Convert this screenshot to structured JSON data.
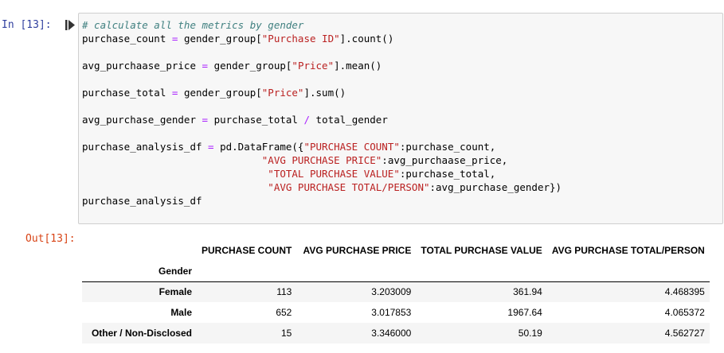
{
  "prompts": {
    "input": "In [13]:",
    "output": "Out[13]:"
  },
  "code": {
    "comment": "# calculate all the metrics by gender",
    "l1": [
      "purchase_count",
      " ",
      "=",
      " gender_group[",
      "\"Purchase ID\"",
      "].count()"
    ],
    "l2": [
      "avg_purchaase_price",
      " ",
      "=",
      " gender_group[",
      "\"Price\"",
      "].mean()"
    ],
    "l3": [
      "purchase_total",
      " ",
      "=",
      " gender_group[",
      "\"Price\"",
      "].sum()"
    ],
    "l4": [
      "avg_purchase_gender",
      " ",
      "=",
      " purchase_total ",
      "/",
      " total_gender"
    ],
    "l5": [
      "purchase_analysis_df",
      " ",
      "=",
      " pd.DataFrame({",
      "\"PURCHASE COUNT\"",
      ":purchase_count,"
    ],
    "l6": [
      "                              ",
      "\"AVG PURCHASE PRICE\"",
      ":avg_purchaase_price,"
    ],
    "l7": [
      "                               ",
      "\"TOTAL PURCHASE VALUE\"",
      ":purchase_total,"
    ],
    "l8": [
      "                               ",
      "\"AVG PURCHASE TOTAL/PERSON\"",
      ":avg_purchase_gender})"
    ],
    "l9": "purchase_analysis_df"
  },
  "table": {
    "columns": [
      "PURCHASE COUNT",
      "AVG PURCHASE PRICE",
      "TOTAL PURCHASE VALUE",
      "AVG PURCHASE TOTAL/PERSON"
    ],
    "index_name": "Gender",
    "rows": [
      {
        "index": "Female",
        "values": [
          "113",
          "3.203009",
          "361.94",
          "4.468395"
        ]
      },
      {
        "index": "Male",
        "values": [
          "652",
          "3.017853",
          "1967.64",
          "4.065372"
        ]
      },
      {
        "index": "Other / Non-Disclosed",
        "values": [
          "15",
          "3.346000",
          "50.19",
          "4.562727"
        ]
      }
    ]
  }
}
